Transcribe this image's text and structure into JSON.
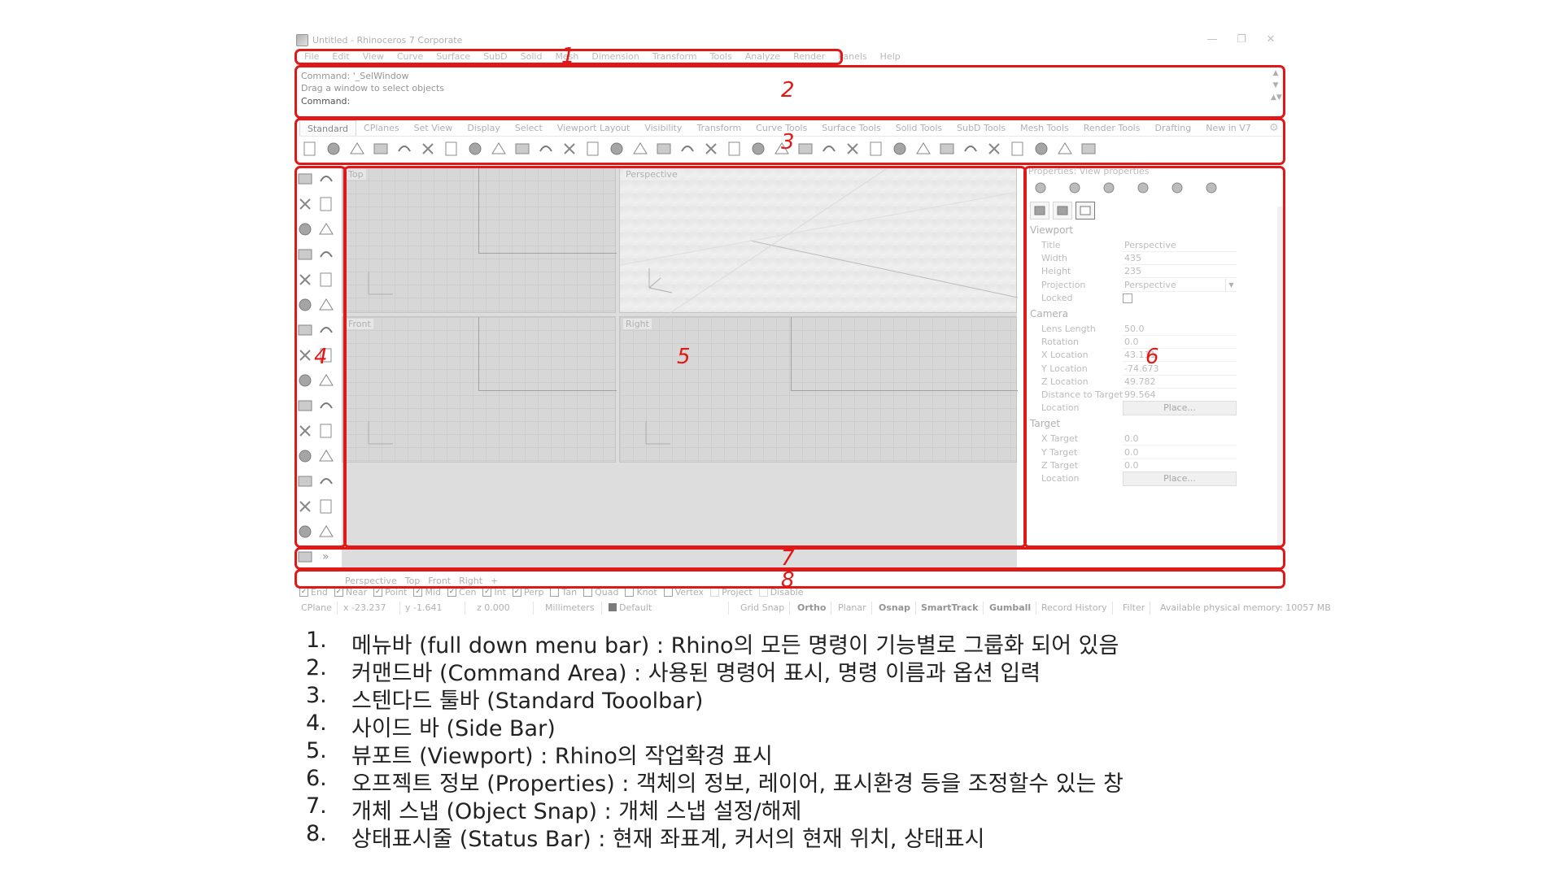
{
  "window": {
    "title": "Untitled - Rhinoceros 7 Corporate",
    "controls": [
      "minimize-icon",
      "restore-icon",
      "close-icon"
    ]
  },
  "menubar": {
    "items": [
      "File",
      "Edit",
      "View",
      "Curve",
      "Surface",
      "SubD",
      "Solid",
      "Mesh",
      "Dimension",
      "Transform",
      "Tools",
      "Analyze",
      "Render",
      "Panels",
      "Help"
    ]
  },
  "command_area": {
    "history": [
      "Command: '_SelWindow",
      "Drag a window to select objects"
    ],
    "prompt": "Command:"
  },
  "toolbar": {
    "tabs": [
      "Standard",
      "CPlanes",
      "Set View",
      "Display",
      "Select",
      "Viewport Layout",
      "Visibility",
      "Transform",
      "Curve Tools",
      "Surface Tools",
      "Solid Tools",
      "SubD Tools",
      "Mesh Tools",
      "Render Tools",
      "Drafting",
      "New in V7"
    ],
    "active_tab": "Standard",
    "icons": [
      "new-file-icon",
      "open-file-icon",
      "save-icon",
      "print-icon",
      "import-icon",
      "cut-icon",
      "copy-icon",
      "paste-icon",
      "undo-icon",
      "pan-hand-icon",
      "move-view-icon",
      "zoom-icon",
      "zoom-window-icon",
      "zoom-extents-icon",
      "zoom-selected-icon",
      "rotate-view-icon",
      "four-view-icon",
      "cplane-icon",
      "grid-snap-icon",
      "select-all-icon",
      "properties-icon",
      "light-icon",
      "layer-icon",
      "shaded-sphere-icon",
      "rendered-sphere-icon",
      "ghosted-sphere-icon",
      "xray-sphere-icon",
      "material-sphere-icon",
      "render-icon",
      "options-icon",
      "osnap-icon",
      "dimension-icon",
      "settings-icon",
      "help-icon"
    ]
  },
  "sidebar": {
    "icons": [
      "select-arrow-icon",
      "point-icon",
      "polyline-icon",
      "curve-icon",
      "circle-icon",
      "ellipse-icon",
      "arc-icon",
      "rectangle-icon",
      "polygon-icon",
      "fillet-icon",
      "surface-icon",
      "extrude-icon",
      "box-icon",
      "sphere-icon",
      "cylinder-icon",
      "boolean-icon",
      "mesh-icon",
      "solid-edit-icon",
      "move-icon",
      "copy-transform-icon",
      "group-icon",
      "array-icon",
      "text-icon",
      "dimension-icon",
      "block-icon",
      "layout-icon",
      "analysis-icon",
      "hatch-icon",
      "grid-icon",
      "align-icon",
      "render-tool-icon",
      "more-icon"
    ]
  },
  "viewports": {
    "views": [
      {
        "name": "Top",
        "projection": "parallel"
      },
      {
        "name": "Perspective",
        "projection": "perspective"
      },
      {
        "name": "Front",
        "projection": "parallel"
      },
      {
        "name": "Right",
        "projection": "parallel"
      }
    ],
    "tabs": [
      "Perspective",
      "Top",
      "Front",
      "Right"
    ],
    "add_tab_icon": "plus-icon"
  },
  "properties": {
    "title": "Properties: View properties",
    "icons": [
      "object-icon",
      "material-icon",
      "render-mesh-icon",
      "texture-icon",
      "folder-icon",
      "image-icon"
    ],
    "sub_icons": [
      "camera-icon",
      "light-source-icon",
      "viewport-frame-icon"
    ],
    "sections": {
      "viewport": {
        "heading": "Viewport",
        "rows": [
          {
            "label": "Title",
            "value": "Perspective"
          },
          {
            "label": "Width",
            "value": "435"
          },
          {
            "label": "Height",
            "value": "235"
          },
          {
            "label": "Projection",
            "value": "Perspective"
          },
          {
            "label": "Locked",
            "value": ""
          }
        ]
      },
      "camera": {
        "heading": "Camera",
        "rows": [
          {
            "label": "Lens Length",
            "value": "50.0"
          },
          {
            "label": "Rotation",
            "value": "0.0"
          },
          {
            "label": "X Location",
            "value": "43.111"
          },
          {
            "label": "Y Location",
            "value": "-74.673"
          },
          {
            "label": "Z Location",
            "value": "49.782"
          },
          {
            "label": "Distance to Target",
            "value": "99.564"
          },
          {
            "label": "Location",
            "value": "Place..."
          }
        ]
      },
      "target": {
        "heading": "Target",
        "rows": [
          {
            "label": "X Target",
            "value": "0.0"
          },
          {
            "label": "Y Target",
            "value": "0.0"
          },
          {
            "label": "Z Target",
            "value": "0.0"
          },
          {
            "label": "Location",
            "value": "Place..."
          }
        ]
      }
    }
  },
  "osnap": {
    "items": [
      {
        "label": "End",
        "checked": true
      },
      {
        "label": "Near",
        "checked": true
      },
      {
        "label": "Point",
        "checked": true
      },
      {
        "label": "Mid",
        "checked": true
      },
      {
        "label": "Cen",
        "checked": true
      },
      {
        "label": "Int",
        "checked": true
      },
      {
        "label": "Perp",
        "checked": true
      },
      {
        "label": "Tan",
        "checked": false
      },
      {
        "label": "Quad",
        "checked": false
      },
      {
        "label": "Knot",
        "checked": false
      },
      {
        "label": "Vertex",
        "checked": false
      },
      {
        "label": "Project",
        "checked": false
      },
      {
        "label": "Disable",
        "checked": false
      }
    ]
  },
  "statusbar": {
    "cplane": "CPlane",
    "x": "x -23.237",
    "y": "y -1.641",
    "z": "z 0.000",
    "units": "Millimeters",
    "layer": "Default",
    "grid_snap": "Grid Snap",
    "ortho": "Ortho",
    "planar": "Planar",
    "osnap": "Osnap",
    "smarttrack": "SmartTrack",
    "gumball": "Gumball",
    "record_history": "Record History",
    "filter": "Filter",
    "memory": "Available physical memory: 10057 MB"
  },
  "annotations": [
    "1",
    "2",
    "3",
    "4",
    "5",
    "6",
    "7",
    "8"
  ],
  "legend": [
    {
      "num": "1.",
      "text": "메뉴바 (full down menu bar) : Rhino의 모든 명령이 기능별로 그룹화 되어 있음"
    },
    {
      "num": "2.",
      "text": "커맨드바 (Command Area) : 사용된 명령어 표시, 명령 이름과 옵션 입력"
    },
    {
      "num": "3.",
      "text": "스텐다드 툴바 (Standard Tooolbar)"
    },
    {
      "num": "4.",
      "text": "사이드 바 (Side Bar)"
    },
    {
      "num": "5.",
      "text": "뷰포트 (Viewport) : Rhino의 작업확경 표시"
    },
    {
      "num": "6.",
      "text": "오프젝트 정보 (Properties) : 객체의 정보, 레이어, 표시환경 등을 조정할수 있는 창"
    },
    {
      "num": "7.",
      "text": "개체 스냅 (Object Snap) : 개체 스냅 설정/해제"
    },
    {
      "num": "8.",
      "text": "상태표시줄 (Status Bar) : 현재 좌표계, 커서의 현재 위치, 상태표시"
    }
  ],
  "colors": {
    "annotation": "#e01818",
    "ui_text": "#9a9a9a",
    "viewport_bg": "#cdcdcd"
  }
}
